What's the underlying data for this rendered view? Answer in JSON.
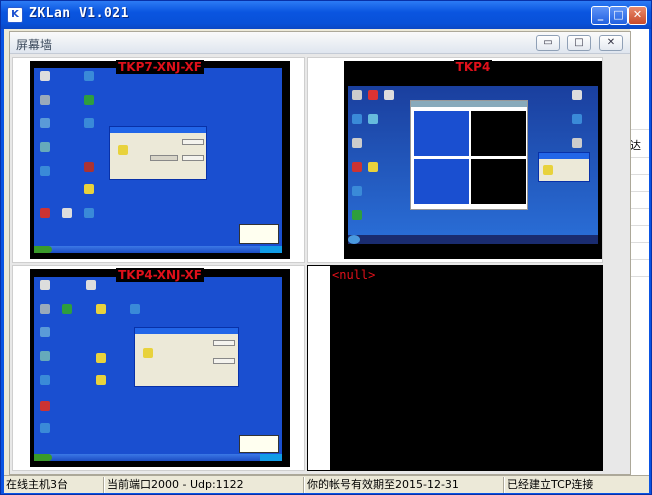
{
  "window": {
    "title": "ZKLan V1.021",
    "icon_text": "K",
    "minimize": "_",
    "maximize": "□",
    "close": "✕"
  },
  "mdi": {
    "title": "屏幕墙",
    "minimize": "▭",
    "maximize": "□",
    "close": "✕"
  },
  "screens": [
    {
      "label": "TKP7-XNJ-XF"
    },
    {
      "label": "TKP4"
    },
    {
      "label": "TKP4-XNJ-XF"
    },
    {
      "label": "<null>"
    }
  ],
  "side_fragment": "达",
  "status": {
    "online": "在线主机3台",
    "port": "当前端口2000 - Udp:1122",
    "expiry": "你的帐号有效期至2015-12-31",
    "connection": "已经建立TCP连接"
  },
  "colors": {
    "accent": "#0a54e3",
    "label_red": "#e0101a",
    "desktop_blue": "#1a4fd0"
  }
}
